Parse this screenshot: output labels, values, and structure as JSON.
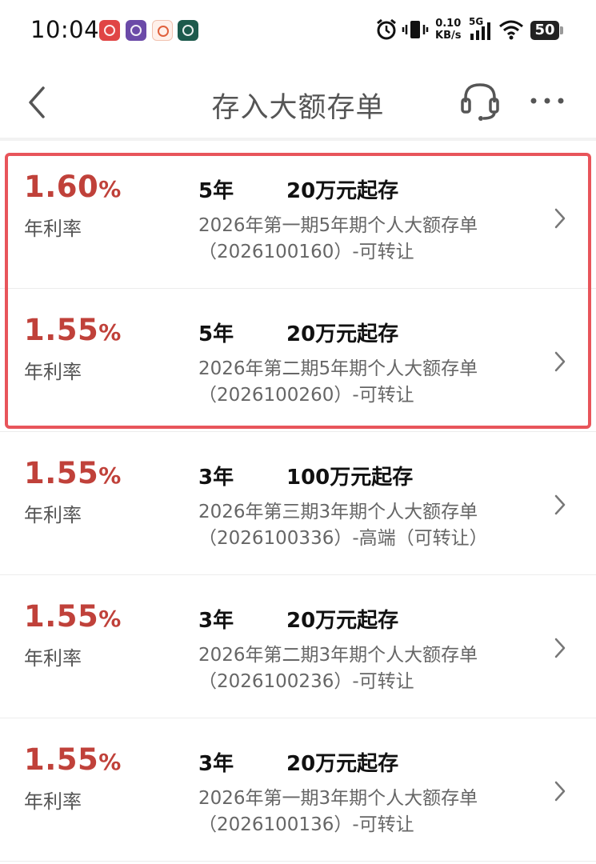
{
  "status_bar": {
    "time": "10:04",
    "net_speed_value": "0.10",
    "net_speed_unit": "KB/s",
    "network_type": "5G",
    "battery_level": "50"
  },
  "nav": {
    "title": "存入大额存单"
  },
  "products": [
    {
      "rate": "1.60",
      "rate_unit": "%",
      "rate_label": "年利率",
      "term": "5年",
      "min_deposit": "20万元起存",
      "name_line1": "2026年第一期5年期个人大额存单",
      "name_line2": "（2026100160）-可转让"
    },
    {
      "rate": "1.55",
      "rate_unit": "%",
      "rate_label": "年利率",
      "term": "5年",
      "min_deposit": "20万元起存",
      "name_line1": "2026年第二期5年期个人大额存单",
      "name_line2": "（2026100260）-可转让"
    },
    {
      "rate": "1.55",
      "rate_unit": "%",
      "rate_label": "年利率",
      "term": "3年",
      "min_deposit": "100万元起存",
      "name_line1": "2026年第三期3年期个人大额存单",
      "name_line2": "（2026100336）-高端（可转让）"
    },
    {
      "rate": "1.55",
      "rate_unit": "%",
      "rate_label": "年利率",
      "term": "3年",
      "min_deposit": "20万元起存",
      "name_line1": "2026年第二期3年期个人大额存单",
      "name_line2": "（2026100236）-可转让"
    },
    {
      "rate": "1.55",
      "rate_unit": "%",
      "rate_label": "年利率",
      "term": "3年",
      "min_deposit": "20万元起存",
      "name_line1": "2026年第一期3年期个人大额存单",
      "name_line2": "（2026100136）-可转让"
    }
  ],
  "colors": {
    "rate_red": "#c0413a",
    "highlight_border": "#e8555b"
  }
}
